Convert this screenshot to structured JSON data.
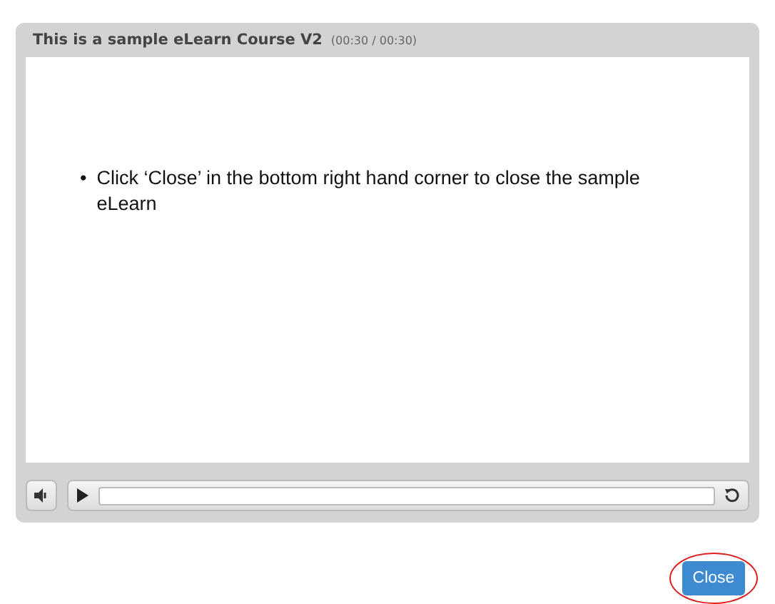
{
  "player": {
    "title": "This is a sample eLearn Course V2",
    "time": "(00:30 / 00:30)",
    "slide": {
      "bullets": [
        {
          "marker": "•",
          "text": "Click ‘Close’ in the bottom right hand corner to close the sample eLearn"
        }
      ]
    },
    "controls": {
      "muted": false,
      "playing": false
    }
  },
  "close_button": {
    "label": "Close",
    "highlighted": true
  }
}
